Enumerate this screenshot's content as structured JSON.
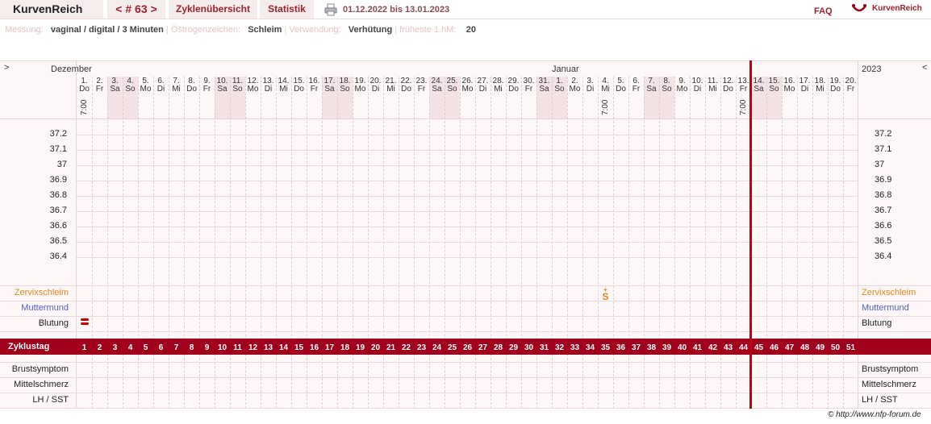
{
  "nav": {
    "brand": "KurvenReich",
    "cycle": "< # 63 >",
    "cycle_overview": "Zyklenübersicht",
    "statistics": "Statistik",
    "date_range": "01.12.2022 bis 13.01.2023",
    "faq": "FAQ",
    "logo_text": "KurvenReich"
  },
  "info": {
    "measure_label": "Messung:",
    "measure_value": "vaginal / digital / 3 Minuten",
    "estrogen_label": "Östrogenzeichen:",
    "estrogen_value": "Schleim",
    "usage_label": "Verwendung:",
    "usage_value": "Verhütung",
    "earliest_label": "früheste 1.hM:",
    "earliest_value": "20",
    "separator": "|"
  },
  "chart_data": {
    "type": "table",
    "month_left": "Dezember",
    "month_mid": "Januar",
    "year": "2023",
    "nav_left": ">",
    "nav_right": "<",
    "day_numbers": [
      "1.",
      "2.",
      "3.",
      "4.",
      "5.",
      "6.",
      "7.",
      "8.",
      "9.",
      "10.",
      "11.",
      "12.",
      "13.",
      "14.",
      "15.",
      "16.",
      "17.",
      "18.",
      "19.",
      "20.",
      "21.",
      "22.",
      "23.",
      "24.",
      "25.",
      "26.",
      "27.",
      "28.",
      "29.",
      "30.",
      "31.",
      "1.",
      "2.",
      "3.",
      "4.",
      "5.",
      "6.",
      "7.",
      "8.",
      "9.",
      "10.",
      "11.",
      "12.",
      "13.",
      "14.",
      "15.",
      "16.",
      "17.",
      "18.",
      "19.",
      "20."
    ],
    "weekdays": [
      "Do",
      "Fr",
      "Sa",
      "So",
      "Mo",
      "Di",
      "Mi",
      "Do",
      "Fr",
      "Sa",
      "So",
      "Mo",
      "Di",
      "Mi",
      "Do",
      "Fr",
      "Sa",
      "So",
      "Mo",
      "Di",
      "Mi",
      "Do",
      "Fr",
      "Sa",
      "So",
      "Mo",
      "Di",
      "Mi",
      "Do",
      "Fr",
      "Sa",
      "So",
      "Mo",
      "Di",
      "Mi",
      "Do",
      "Fr",
      "Sa",
      "So",
      "Mo",
      "Di",
      "Mi",
      "Do",
      "Fr",
      "Sa",
      "So",
      "Mo",
      "Di",
      "Mi",
      "Do",
      "Fr"
    ],
    "weekend_days": [
      3,
      4,
      10,
      11,
      17,
      18,
      24,
      25,
      31,
      32,
      38,
      39,
      45,
      46
    ],
    "times": [
      {
        "day": 1,
        "text": "7:00"
      },
      {
        "day": 35,
        "text": "7:00"
      },
      {
        "day": 44,
        "text": "7:00"
      }
    ],
    "temperature_ticks": [
      "37.2",
      "37.1",
      "37",
      "36.9",
      "36.8",
      "36.7",
      "36.6",
      "36.5",
      "36.4"
    ],
    "cycle_days": [
      "1",
      "2",
      "3",
      "4",
      "5",
      "6",
      "7",
      "8",
      "9",
      "10",
      "11",
      "12",
      "13",
      "14",
      "15",
      "16",
      "17",
      "18",
      "19",
      "20",
      "21",
      "22",
      "23",
      "24",
      "25",
      "26",
      "27",
      "28",
      "29",
      "30",
      "31",
      "32",
      "33",
      "34",
      "35",
      "36",
      "37",
      "38",
      "39",
      "40",
      "41",
      "42",
      "43",
      "44",
      "45",
      "46",
      "47",
      "48",
      "49",
      "50",
      "51"
    ],
    "current_day": 45,
    "mucus_symbol": {
      "day": 35,
      "text": "S",
      "sup": "+"
    },
    "bleeding": [
      {
        "day": 1,
        "level": 2
      }
    ],
    "row_labels": {
      "mucus": "Zervixschleim",
      "cervix": "Muttermund",
      "bleeding": "Blutung",
      "cycle_day": "Zyklustag",
      "breast": "Brustsymptom",
      "pain": "Mittelschmerz",
      "lh": "LH / SST"
    }
  },
  "colors": {
    "accent": "#a0001c",
    "mucus": "#e0881e",
    "cervix": "#4a5fd0"
  },
  "footer": "© http://www.nfp-forum.de"
}
